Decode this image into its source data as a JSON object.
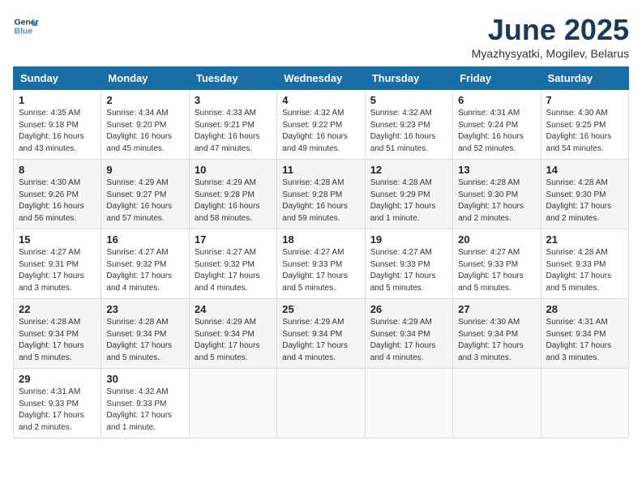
{
  "logo": {
    "line1": "General",
    "line2": "Blue"
  },
  "title": "June 2025",
  "location": "Myazhysyatki, Mogilev, Belarus",
  "weekdays": [
    "Sunday",
    "Monday",
    "Tuesday",
    "Wednesday",
    "Thursday",
    "Friday",
    "Saturday"
  ],
  "weeks": [
    [
      {
        "day": "1",
        "info": "Sunrise: 4:35 AM\nSunset: 9:18 PM\nDaylight: 16 hours\nand 43 minutes."
      },
      {
        "day": "2",
        "info": "Sunrise: 4:34 AM\nSunset: 9:20 PM\nDaylight: 16 hours\nand 45 minutes."
      },
      {
        "day": "3",
        "info": "Sunrise: 4:33 AM\nSunset: 9:21 PM\nDaylight: 16 hours\nand 47 minutes."
      },
      {
        "day": "4",
        "info": "Sunrise: 4:32 AM\nSunset: 9:22 PM\nDaylight: 16 hours\nand 49 minutes."
      },
      {
        "day": "5",
        "info": "Sunrise: 4:32 AM\nSunset: 9:23 PM\nDaylight: 16 hours\nand 51 minutes."
      },
      {
        "day": "6",
        "info": "Sunrise: 4:31 AM\nSunset: 9:24 PM\nDaylight: 16 hours\nand 52 minutes."
      },
      {
        "day": "7",
        "info": "Sunrise: 4:30 AM\nSunset: 9:25 PM\nDaylight: 16 hours\nand 54 minutes."
      }
    ],
    [
      {
        "day": "8",
        "info": "Sunrise: 4:30 AM\nSunset: 9:26 PM\nDaylight: 16 hours\nand 56 minutes."
      },
      {
        "day": "9",
        "info": "Sunrise: 4:29 AM\nSunset: 9:27 PM\nDaylight: 16 hours\nand 57 minutes."
      },
      {
        "day": "10",
        "info": "Sunrise: 4:29 AM\nSunset: 9:28 PM\nDaylight: 16 hours\nand 58 minutes."
      },
      {
        "day": "11",
        "info": "Sunrise: 4:28 AM\nSunset: 9:28 PM\nDaylight: 16 hours\nand 59 minutes."
      },
      {
        "day": "12",
        "info": "Sunrise: 4:28 AM\nSunset: 9:29 PM\nDaylight: 17 hours\nand 1 minute."
      },
      {
        "day": "13",
        "info": "Sunrise: 4:28 AM\nSunset: 9:30 PM\nDaylight: 17 hours\nand 2 minutes."
      },
      {
        "day": "14",
        "info": "Sunrise: 4:28 AM\nSunset: 9:30 PM\nDaylight: 17 hours\nand 2 minutes."
      }
    ],
    [
      {
        "day": "15",
        "info": "Sunrise: 4:27 AM\nSunset: 9:31 PM\nDaylight: 17 hours\nand 3 minutes."
      },
      {
        "day": "16",
        "info": "Sunrise: 4:27 AM\nSunset: 9:32 PM\nDaylight: 17 hours\nand 4 minutes."
      },
      {
        "day": "17",
        "info": "Sunrise: 4:27 AM\nSunset: 9:32 PM\nDaylight: 17 hours\nand 4 minutes."
      },
      {
        "day": "18",
        "info": "Sunrise: 4:27 AM\nSunset: 9:33 PM\nDaylight: 17 hours\nand 5 minutes."
      },
      {
        "day": "19",
        "info": "Sunrise: 4:27 AM\nSunset: 9:33 PM\nDaylight: 17 hours\nand 5 minutes."
      },
      {
        "day": "20",
        "info": "Sunrise: 4:27 AM\nSunset: 9:33 PM\nDaylight: 17 hours\nand 5 minutes."
      },
      {
        "day": "21",
        "info": "Sunrise: 4:28 AM\nSunset: 9:33 PM\nDaylight: 17 hours\nand 5 minutes."
      }
    ],
    [
      {
        "day": "22",
        "info": "Sunrise: 4:28 AM\nSunset: 9:34 PM\nDaylight: 17 hours\nand 5 minutes."
      },
      {
        "day": "23",
        "info": "Sunrise: 4:28 AM\nSunset: 9:34 PM\nDaylight: 17 hours\nand 5 minutes."
      },
      {
        "day": "24",
        "info": "Sunrise: 4:29 AM\nSunset: 9:34 PM\nDaylight: 17 hours\nand 5 minutes."
      },
      {
        "day": "25",
        "info": "Sunrise: 4:29 AM\nSunset: 9:34 PM\nDaylight: 17 hours\nand 4 minutes."
      },
      {
        "day": "26",
        "info": "Sunrise: 4:29 AM\nSunset: 9:34 PM\nDaylight: 17 hours\nand 4 minutes."
      },
      {
        "day": "27",
        "info": "Sunrise: 4:30 AM\nSunset: 9:34 PM\nDaylight: 17 hours\nand 3 minutes."
      },
      {
        "day": "28",
        "info": "Sunrise: 4:31 AM\nSunset: 9:34 PM\nDaylight: 17 hours\nand 3 minutes."
      }
    ],
    [
      {
        "day": "29",
        "info": "Sunrise: 4:31 AM\nSunset: 9:33 PM\nDaylight: 17 hours\nand 2 minutes."
      },
      {
        "day": "30",
        "info": "Sunrise: 4:32 AM\nSunset: 9:33 PM\nDaylight: 17 hours\nand 1 minute."
      },
      {
        "day": "",
        "info": ""
      },
      {
        "day": "",
        "info": ""
      },
      {
        "day": "",
        "info": ""
      },
      {
        "day": "",
        "info": ""
      },
      {
        "day": "",
        "info": ""
      }
    ]
  ]
}
